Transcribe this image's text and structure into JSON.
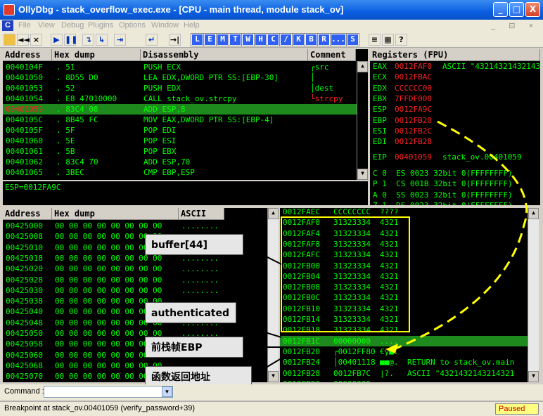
{
  "window": {
    "title": "OllyDbg - stack_overflow_exec.exe - [CPU - main thread, module stack_ov]",
    "min": "_",
    "max": "□",
    "close": "X",
    "mdi_controls": "_ ⊡ ×"
  },
  "menu": [
    "File",
    "View",
    "Debug",
    "Plugins",
    "Options",
    "Window",
    "Help"
  ],
  "toolbar": {
    "buttons": [
      "◄◄",
      "×",
      "▶",
      "❚❚",
      "↴",
      "↳",
      "⇥",
      "↵",
      "→|"
    ],
    "letters": [
      "L",
      "E",
      "M",
      "T",
      "W",
      "H",
      "C",
      "/",
      "K",
      "B",
      "R",
      "...",
      "S"
    ],
    "tail": [
      "≡",
      "▦",
      "?"
    ]
  },
  "disasm": {
    "headers": {
      "address": "Address",
      "hex": "Hex dump",
      "dis": "Disassembly",
      "comment": "Comment"
    },
    "rows": [
      {
        "addr": "0040104F",
        "hex": ". 51",
        "dis": "PUSH ECX",
        "comment": "┌src"
      },
      {
        "addr": "00401050",
        "hex": ". 8D55 D0",
        "dis": "LEA EDX,DWORD PTR SS:[EBP-30]",
        "comment": "│"
      },
      {
        "addr": "00401053",
        "hex": ". 52",
        "dis": "PUSH EDX",
        "comment": "│dest"
      },
      {
        "addr": "00401054",
        "hex": ". E8 47010000",
        "dis": "CALL stack_ov.strcpy",
        "comment": "└strcpy"
      },
      {
        "addr": "00401059",
        "hex": ". 83C4 08",
        "dis": "ADD ESP,8",
        "comment": ""
      },
      {
        "addr": "0040105C",
        "hex": ". 8B45 FC",
        "dis": "MOV EAX,DWORD PTR SS:[EBP-4]",
        "comment": ""
      },
      {
        "addr": "0040105F",
        "hex": ". 5F",
        "dis": "POP EDI",
        "comment": ""
      },
      {
        "addr": "00401060",
        "hex": ". 5E",
        "dis": "POP ESI",
        "comment": ""
      },
      {
        "addr": "00401061",
        "hex": ". 5B",
        "dis": "POP EBX",
        "comment": ""
      },
      {
        "addr": "00401062",
        "hex": ". 83C4 70",
        "dis": "ADD ESP,70",
        "comment": ""
      },
      {
        "addr": "00401065",
        "hex": ". 3BEC",
        "dis": "CMP EBP,ESP",
        "comment": ""
      }
    ],
    "info": "ESP=0012FA9C"
  },
  "registers": {
    "header": "Registers (FPU)",
    "rows": [
      {
        "name": "EAX",
        "val": "0012FAF0",
        "extra": "ASCII \"4321432143214321"
      },
      {
        "name": "ECX",
        "val": "0012FBAC",
        "extra": ""
      },
      {
        "name": "EDX",
        "val": "CCCCCC00",
        "extra": ""
      },
      {
        "name": "EBX",
        "val": "7FFDF000",
        "extra": ""
      },
      {
        "name": "ESP",
        "val": "0012FA9C",
        "extra": ""
      },
      {
        "name": "EBP",
        "val": "0012FB20",
        "extra": ""
      },
      {
        "name": "ESI",
        "val": "0012FB2C",
        "extra": ""
      },
      {
        "name": "EDI",
        "val": "0012FB28",
        "extra": ""
      }
    ],
    "eip": {
      "name": "EIP",
      "val": "00401059",
      "extra": "stack_ov.00401059"
    },
    "flags": [
      "C 0  ES 0023 32bit 0(FFFFFFFF)",
      "P 1  CS 001B 32bit 0(FFFFFFFF)",
      "A 0  SS 0023 32bit 0(FFFFFFFF)",
      "Z 1  DS 0023 32bit 0(FFFFFFFF)"
    ]
  },
  "dump": {
    "headers": {
      "address": "Address",
      "hex": "Hex dump",
      "ascii": "ASCII"
    },
    "rows": [
      {
        "addr": "00425000",
        "hex": "00 00 00 00 00 00 00 00",
        "ascii": "........"
      },
      {
        "addr": "00425008",
        "hex": "00 00 00 00 00 00 00 00",
        "ascii": "........"
      },
      {
        "addr": "00425010",
        "hex": "00 00 00 00 00 00 00 00",
        "ascii": "........"
      },
      {
        "addr": "00425018",
        "hex": "00 00 00 00 00 00 00 00",
        "ascii": "........"
      },
      {
        "addr": "00425020",
        "hex": "00 00 00 00 00 00 00 00",
        "ascii": "........"
      },
      {
        "addr": "00425028",
        "hex": "00 00 00 00 00 00 00 00",
        "ascii": "........"
      },
      {
        "addr": "00425030",
        "hex": "00 00 00 00 00 00 00 00",
        "ascii": "........"
      },
      {
        "addr": "00425038",
        "hex": "00 00 00 00 00 00 00 00",
        "ascii": "........"
      },
      {
        "addr": "00425040",
        "hex": "00 00 00 00 00 00 00 00",
        "ascii": "........"
      },
      {
        "addr": "00425048",
        "hex": "00 00 00 00 00 00 00 00",
        "ascii": "........"
      },
      {
        "addr": "00425050",
        "hex": "00 00 00 00 00 00 00 00",
        "ascii": "........"
      },
      {
        "addr": "00425058",
        "hex": "00 00 00 00 00 00 00 00",
        "ascii": "........"
      },
      {
        "addr": "00425060",
        "hex": "00 00 00 00 00 00 00 00",
        "ascii": "........"
      },
      {
        "addr": "00425068",
        "hex": "00 00 00 00 00 00 00 00",
        "ascii": "........"
      },
      {
        "addr": "00425070",
        "hex": "00 00 00 00 00 00 00 00",
        "ascii": "........"
      }
    ]
  },
  "stack": {
    "rows": [
      {
        "addr": "0012FAEC",
        "val": "CCCCCCCC",
        "ascii": "????",
        "comment": ""
      },
      {
        "addr": "0012FAF0",
        "val": "31323334",
        "ascii": "4321",
        "comment": ""
      },
      {
        "addr": "0012FAF4",
        "val": "31323334",
        "ascii": "4321",
        "comment": ""
      },
      {
        "addr": "0012FAF8",
        "val": "31323334",
        "ascii": "4321",
        "comment": ""
      },
      {
        "addr": "0012FAFC",
        "val": "31323334",
        "ascii": "4321",
        "comment": ""
      },
      {
        "addr": "0012FB00",
        "val": "31323334",
        "ascii": "4321",
        "comment": ""
      },
      {
        "addr": "0012FB04",
        "val": "31323334",
        "ascii": "4321",
        "comment": ""
      },
      {
        "addr": "0012FB08",
        "val": "31323334",
        "ascii": "4321",
        "comment": ""
      },
      {
        "addr": "0012FB0C",
        "val": "31323334",
        "ascii": "4321",
        "comment": ""
      },
      {
        "addr": "0012FB10",
        "val": "31323334",
        "ascii": "4321",
        "comment": ""
      },
      {
        "addr": "0012FB14",
        "val": "31323334",
        "ascii": "4321",
        "comment": ""
      },
      {
        "addr": "0012FB18",
        "val": "31323334",
        "ascii": "4321",
        "comment": ""
      },
      {
        "addr": "0012FB1C",
        "val": "00000000",
        "ascii": "....",
        "comment": ""
      },
      {
        "addr": "0012FB20",
        "val": "┌0012FF80",
        "ascii": "€ÿ■.",
        "comment": ""
      },
      {
        "addr": "0012FB24",
        "val": "│00401118",
        "ascii": "■■@.",
        "comment": "RETURN to stack_ov.main"
      },
      {
        "addr": "0012FB28",
        "val": "0012FB7C",
        "ascii": "|?.",
        "comment": "ASCII \"4321432143214321"
      },
      {
        "addr": "0012FB2C",
        "val": "00000000",
        "ascii": "....",
        "comment": ""
      }
    ]
  },
  "callouts": {
    "buffer": "buffer[44]",
    "authenticated": "authenticated",
    "ebp": "前栈帧EBP",
    "ret": "函数返回地址"
  },
  "command": {
    "label": "Command :",
    "value": ""
  },
  "status": {
    "text": "Breakpoint at stack_ov.00401059 (verify_password+39)",
    "state": "Paused"
  },
  "colors": {
    "accent_red": "#ff2020",
    "highlight": "#ffff00",
    "paused": "#ffff80"
  }
}
